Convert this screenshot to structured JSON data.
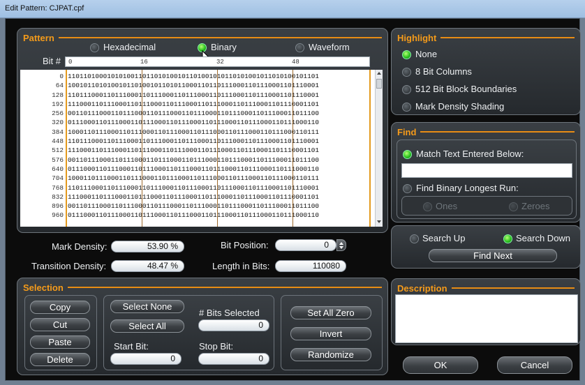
{
  "window": {
    "title": "Edit Pattern: CJPAT.cpf"
  },
  "pattern": {
    "title": "Pattern",
    "formats": [
      {
        "label": "Hexadecimal",
        "selected": false
      },
      {
        "label": "Binary",
        "selected": true
      },
      {
        "label": "Waveform",
        "selected": false
      }
    ],
    "bit_header_label": "Bit #",
    "ruler": [
      "0",
      "16",
      "32",
      "48"
    ],
    "rows": [
      {
        "addr": "0",
        "bits": "1101101000101010011011010100101101001010110101001011010100101101"
      },
      {
        "addr": "64",
        "bits": "1001011010100101101001011010110001101101110001101110001101110001"
      },
      {
        "addr": "128",
        "bits": "1101110001101110001101110001101110001101110001101110001101110001"
      },
      {
        "addr": "192",
        "bits": "1110001101110001101110001101110001101110001101110001101110001101"
      },
      {
        "addr": "256",
        "bits": "0011011100011011100011011100011011100011011100011011100011011100"
      },
      {
        "addr": "320",
        "bits": "0111000110111000110111000110111000110111000110111000110111000110"
      },
      {
        "addr": "384",
        "bits": "1000110111000110111000110111000110111000110111000110111000110111"
      },
      {
        "addr": "448",
        "bits": "1101110001101110001101110001101110001101110001101110001101110001"
      },
      {
        "addr": "512",
        "bits": "1110001101110001101110001101110001101110001101110001101110001101"
      },
      {
        "addr": "576",
        "bits": "0011011100011011100011011100011011100011011100011011100011011100"
      },
      {
        "addr": "640",
        "bits": "0111000110111000110111000110111000110111000110111000110111000110"
      },
      {
        "addr": "704",
        "bits": "1000110111000110111000110111000110111000110111000110111000110111"
      },
      {
        "addr": "768",
        "bits": "1101110001101110001101110001101110001101110001101110001101110001"
      },
      {
        "addr": "832",
        "bits": "1110001101110001101110001101110001101110001101110001101110001101"
      },
      {
        "addr": "896",
        "bits": "0011011100011011100011011100011011100011011100011011100011011100"
      },
      {
        "addr": "960",
        "bits": "0111000110111000110111000110111000110111000110111000110111000110"
      }
    ]
  },
  "stats": {
    "mark_density_label": "Mark Density:",
    "mark_density": "53.90 %",
    "transition_density_label": "Transition Density:",
    "transition_density": "48.47 %",
    "bit_position_label": "Bit Position:",
    "bit_position": "0",
    "length_label": "Length in Bits:",
    "length": "110080"
  },
  "highlight": {
    "title": "Highlight",
    "options": [
      {
        "label": "None",
        "selected": true
      },
      {
        "label": "8 Bit Columns",
        "selected": false
      },
      {
        "label": "512 Bit Block Boundaries",
        "selected": false
      },
      {
        "label": "Mark Density Shading",
        "selected": false
      }
    ]
  },
  "find": {
    "title": "Find",
    "match_text_label": "Match Text Entered Below:",
    "match_text_value": "",
    "longest_run_label": "Find Binary Longest Run:",
    "ones_label": "Ones",
    "zeroes_label": "Zeroes",
    "search_up_label": "Search Up",
    "search_down_label": "Search Down",
    "find_next_label": "Find Next"
  },
  "selection": {
    "title": "Selection",
    "copy": "Copy",
    "cut": "Cut",
    "paste": "Paste",
    "delete": "Delete",
    "select_none": "Select None",
    "select_all": "Select All",
    "bits_selected_label": "# Bits Selected",
    "bits_selected": "0",
    "start_bit_label": "Start Bit:",
    "start_bit": "0",
    "stop_bit_label": "Stop Bit:",
    "stop_bit": "0",
    "set_all_zero": "Set All Zero",
    "invert": "Invert",
    "randomize": "Randomize"
  },
  "description": {
    "title": "Description",
    "text": ""
  },
  "dialog": {
    "ok": "OK",
    "cancel": "Cancel"
  }
}
